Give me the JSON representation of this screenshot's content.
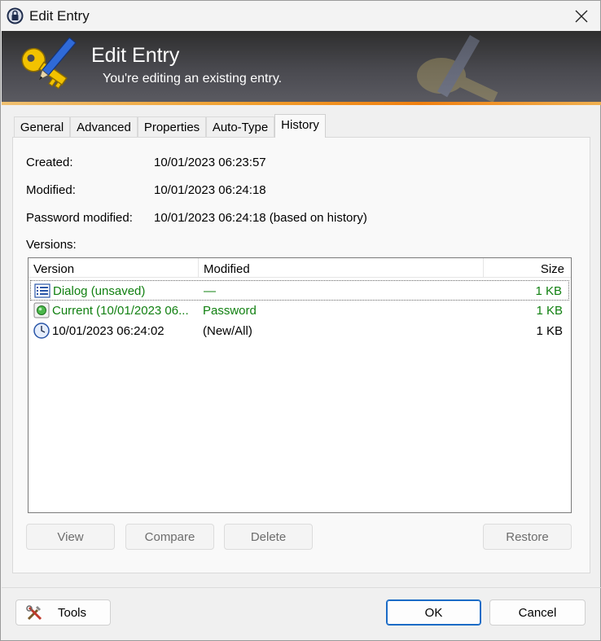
{
  "window": {
    "title": "Edit Entry"
  },
  "banner": {
    "title": "Edit Entry",
    "subtitle": "You're editing an existing entry."
  },
  "tabs": [
    {
      "label": "General"
    },
    {
      "label": "Advanced"
    },
    {
      "label": "Properties"
    },
    {
      "label": "Auto-Type"
    },
    {
      "label": "History",
      "active": true
    }
  ],
  "history": {
    "created_label": "Created:",
    "created_value": "10/01/2023 06:23:57",
    "modified_label": "Modified:",
    "modified_value": "10/01/2023 06:24:18",
    "pw_modified_label": "Password modified:",
    "pw_modified_value": "10/01/2023 06:24:18 (based on history)",
    "versions_label": "Versions:",
    "columns": [
      "Version",
      "Modified",
      "Size"
    ],
    "rows": [
      {
        "version": "Dialog (unsaved)",
        "modified": "—",
        "size": "1 KB",
        "icon": "list-icon",
        "color": "#118011"
      },
      {
        "version": "Current (10/01/2023 06...",
        "modified": "Password",
        "size": "1 KB",
        "icon": "green-dot-icon",
        "color": "#118011"
      },
      {
        "version": "10/01/2023 06:24:02",
        "modified": "(New/All)",
        "size": "1 KB",
        "icon": "clock-icon",
        "color": "#000000"
      }
    ],
    "buttons": {
      "view": "View",
      "compare": "Compare",
      "delete": "Delete",
      "restore": "Restore"
    }
  },
  "footer": {
    "tools": "Tools",
    "ok": "OK",
    "cancel": "Cancel"
  },
  "colors": {
    "banner_dark": "#2e2e2e",
    "accent_orange": "#f08010",
    "ok_border": "#1a6bc6",
    "green_text": "#118011"
  }
}
